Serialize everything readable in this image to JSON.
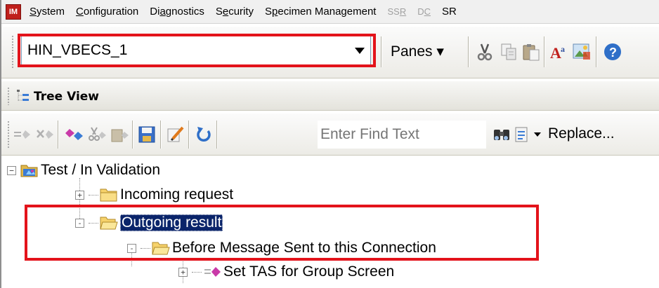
{
  "menubar": {
    "logo_text": "IM",
    "items": [
      {
        "pre": "",
        "mn": "S",
        "post": "ystem",
        "disabled": false
      },
      {
        "pre": "",
        "mn": "C",
        "post": "onfiguration",
        "disabled": false
      },
      {
        "pre": "Di",
        "mn": "a",
        "post": "gnostics",
        "disabled": false
      },
      {
        "pre": "S",
        "mn": "e",
        "post": "curity",
        "disabled": false
      },
      {
        "pre": "S",
        "mn": "p",
        "post": "ecimen Management",
        "disabled": false
      },
      {
        "pre": "SS",
        "mn": "R",
        "post": "",
        "disabled": true
      },
      {
        "pre": "D",
        "mn": "C",
        "post": "",
        "disabled": true
      },
      {
        "pre": "SR",
        "mn": "",
        "post": "",
        "disabled": false
      }
    ]
  },
  "toolbar1": {
    "connection_value": "HIN_VBECS_1",
    "panes_label": "Panes ▾",
    "icons": [
      "cut-icon",
      "copy-icon",
      "paste-icon",
      "font-icon",
      "image-icon",
      "help-icon"
    ]
  },
  "tree_panel": {
    "title": "Tree View"
  },
  "toolbar2": {
    "find_placeholder": "Enter Find Text",
    "replace_label": "Replace..."
  },
  "tree": {
    "root_label": "Test / In Validation",
    "items": [
      {
        "label": "Incoming request",
        "expander": "+"
      },
      {
        "label": "Outgoing result",
        "expander": "-"
      },
      {
        "label": "Before Message Sent to this Connection",
        "expander": "-"
      },
      {
        "label": "Set TAS for Group Screen",
        "expander": "+"
      }
    ]
  },
  "colors": {
    "highlight_red": "#e3131b",
    "selection_blue": "#0a246a",
    "folder_yellow": "#f6d26b"
  }
}
